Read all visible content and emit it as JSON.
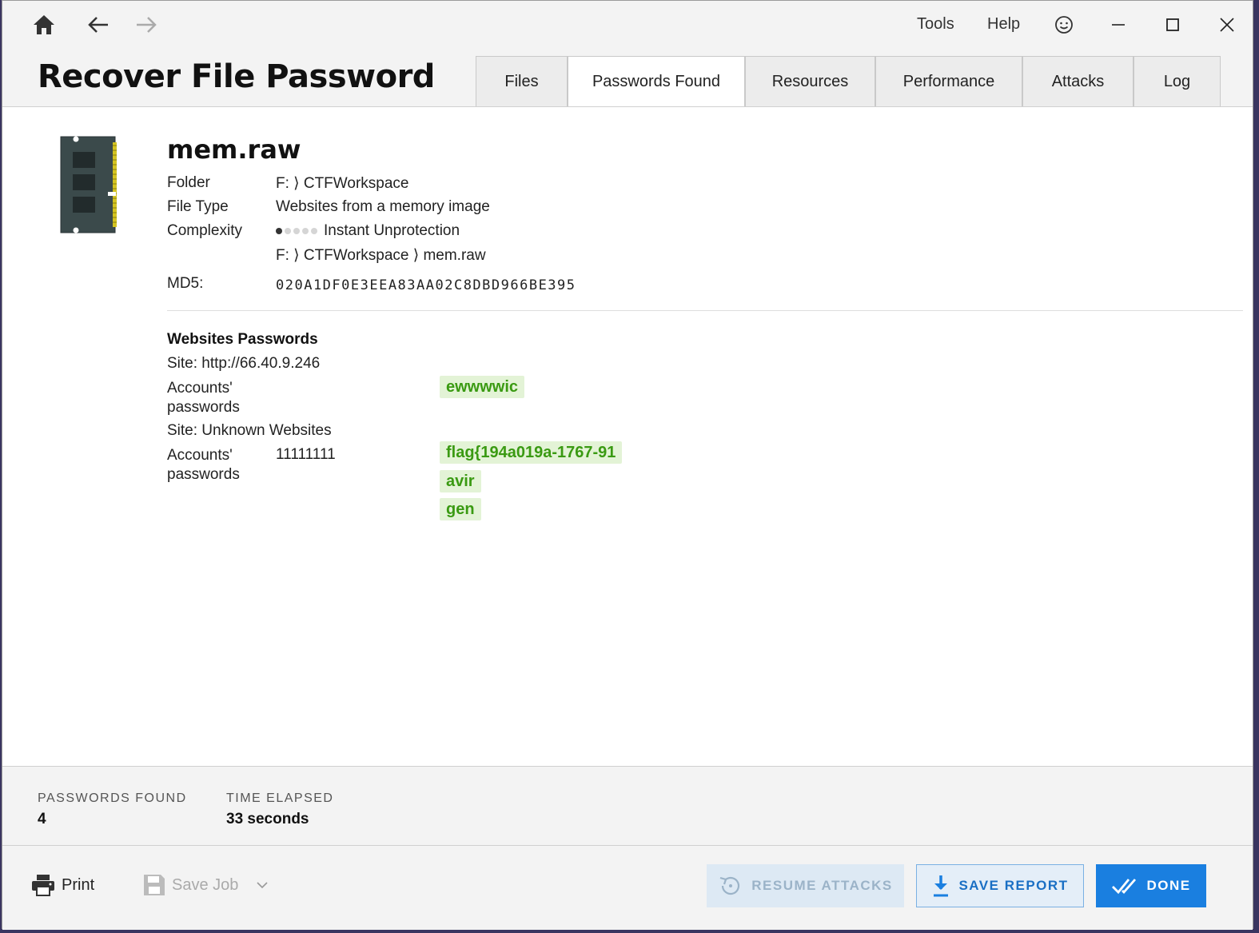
{
  "menu": {
    "tools": "Tools",
    "help": "Help"
  },
  "app": {
    "title": "Recover File Password"
  },
  "tabs": [
    {
      "label": "Files"
    },
    {
      "label": "Passwords Found"
    },
    {
      "label": "Resources"
    },
    {
      "label": "Performance"
    },
    {
      "label": "Attacks"
    },
    {
      "label": "Log"
    }
  ],
  "active_tab": "Passwords Found",
  "file": {
    "name": "mem.raw",
    "folder_label": "Folder",
    "folder_value": "F: ⟩ CTFWorkspace",
    "type_label": "File Type",
    "type_value": "Websites from a memory image",
    "complexity_label": "Complexity",
    "complexity_value": "Instant Unprotection",
    "complexity_level": 1,
    "complexity_max": 5,
    "path": "F: ⟩ CTFWorkspace ⟩ mem.raw",
    "md5_label": "MD5:",
    "md5_value": "020A1DF0E3EEA83AA02C8DBD966BE395"
  },
  "results": {
    "section_title": "Websites Passwords",
    "site1_label": "Site: http://66.40.9.246",
    "site1_accounts_label_1": "Accounts'",
    "site1_accounts_label_2": "passwords",
    "site1_passwords": [
      "ewwwwic"
    ],
    "site2_label": "Site: Unknown Websites",
    "site2_accounts_label_1": "Accounts'",
    "site2_accounts_label_2": "passwords",
    "site2_account": "11111111",
    "site2_passwords": [
      "flag{194a019a-1767-91",
      "avir",
      "gen"
    ]
  },
  "stats": {
    "passwords_found_label": "PASSWORDS FOUND",
    "passwords_found_value": "4",
    "time_elapsed_label": "TIME ELAPSED",
    "time_elapsed_value": "33 seconds"
  },
  "footer": {
    "print_label": "Print",
    "save_job_label": "Save Job",
    "resume_label": "RESUME ATTACKS",
    "save_report_label": "SAVE REPORT",
    "done_label": "DONE"
  },
  "colors": {
    "accent": "#1a7fe0",
    "password_text": "#3a9a12",
    "password_bg": "#e3f3d6"
  }
}
